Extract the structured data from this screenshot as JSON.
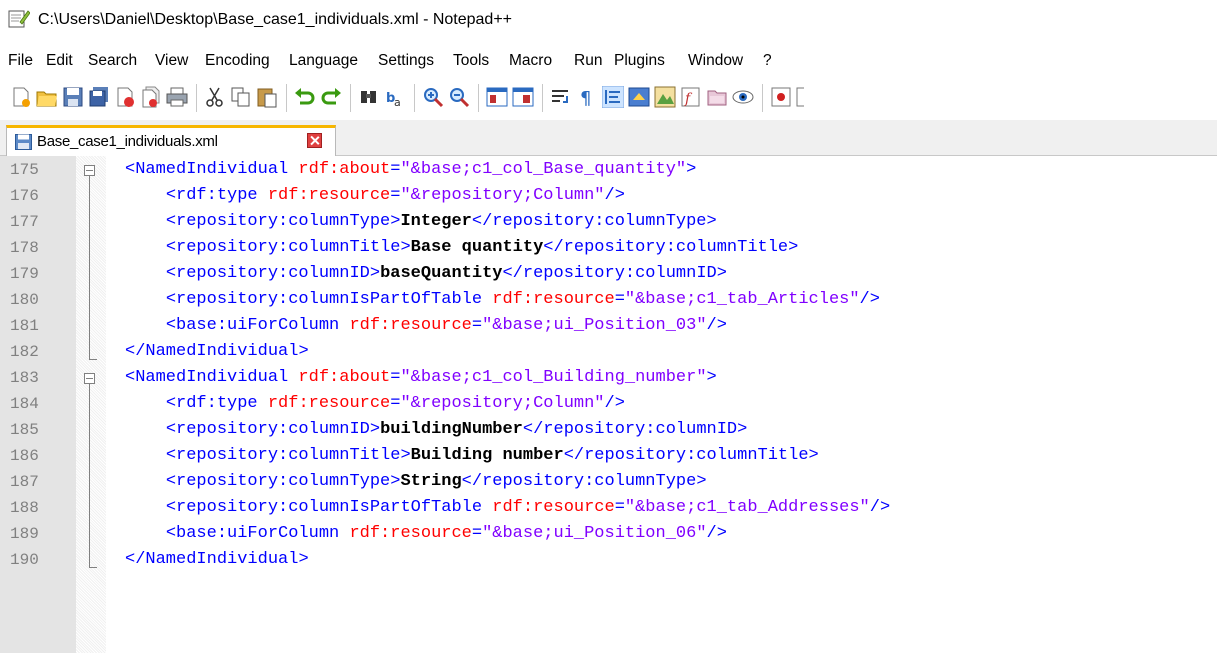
{
  "window": {
    "title": "C:\\Users\\Daniel\\Desktop\\Base_case1_individuals.xml - Notepad++",
    "icon": "notepad-plus-plus-icon"
  },
  "menu": [
    "File",
    "Edit",
    "Search",
    "View",
    "Encoding",
    "Language",
    "Settings",
    "Tools",
    "Macro",
    "Run",
    "Plugins",
    "Window",
    "?"
  ],
  "toolbar": {
    "buttons": [
      "new",
      "open",
      "save",
      "save-all",
      "close",
      "close-all",
      "print",
      "cut",
      "copy",
      "paste",
      "undo",
      "redo",
      "find",
      "replace",
      "zoom-in",
      "zoom-out",
      "sync-vertical",
      "sync-horizontal",
      "word-wrap",
      "show-all-characters",
      "indent-guide",
      "user-defined-language",
      "document-map",
      "function-list",
      "folder-as-workspace",
      "monitoring",
      "record-macro"
    ]
  },
  "tab": {
    "label": "Base_case1_individuals.xml",
    "icon": "saved-file-icon",
    "close": "close-tab-icon"
  },
  "editor": {
    "lines": [
      {
        "num": "175",
        "text": "<NamedIndividual rdf:about=\"&base;c1_col_Base_quantity\">"
      },
      {
        "num": "176",
        "text": "    <rdf:type rdf:resource=\"&repository;Column\"/>"
      },
      {
        "num": "177",
        "text": "    <repository:columnType>Integer</repository:columnType>"
      },
      {
        "num": "178",
        "text": "    <repository:columnTitle>Base quantity</repository:columnTitle>"
      },
      {
        "num": "179",
        "text": "    <repository:columnID>baseQuantity</repository:columnID>"
      },
      {
        "num": "180",
        "text": "    <repository:columnIsPartOfTable rdf:resource=\"&base;c1_tab_Articles\"/>"
      },
      {
        "num": "181",
        "text": "    <base:uiForColumn rdf:resource=\"&base;ui_Position_03\"/>"
      },
      {
        "num": "182",
        "text": "</NamedIndividual>"
      },
      {
        "num": "183",
        "text": "<NamedIndividual rdf:about=\"&base;c1_col_Building_number\">"
      },
      {
        "num": "184",
        "text": "    <rdf:type rdf:resource=\"&repository;Column\"/>"
      },
      {
        "num": "185",
        "text": "    <repository:columnID>buildingNumber</repository:columnID>"
      },
      {
        "num": "186",
        "text": "    <repository:columnTitle>Building number</repository:columnTitle>"
      },
      {
        "num": "187",
        "text": "    <repository:columnType>String</repository:columnType>"
      },
      {
        "num": "188",
        "text": "    <repository:columnIsPartOfTable rdf:resource=\"&base;c1_tab_Addresses\"/>"
      },
      {
        "num": "189",
        "text": "    <base:uiForColumn rdf:resource=\"&base;ui_Position_06\"/>"
      },
      {
        "num": "190",
        "text": "</NamedIndividual>"
      }
    ]
  },
  "colors": {
    "tag": "#0000ff",
    "attribute": "#ff0000",
    "value": "#8000ff",
    "text": "#000000",
    "line_number": "#808080",
    "active_tab_accent": "#f7b600"
  }
}
